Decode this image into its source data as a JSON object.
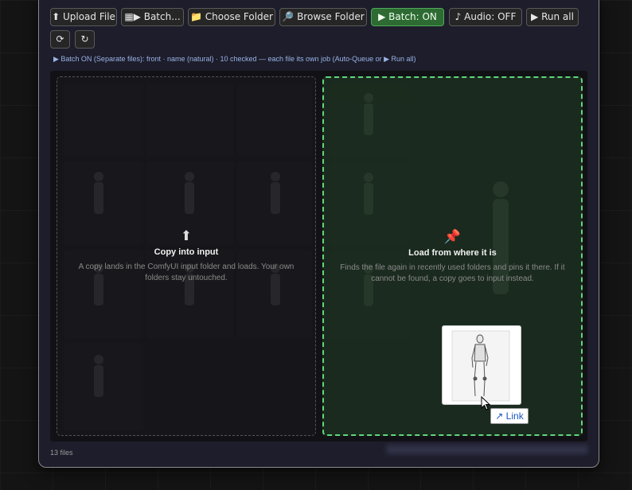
{
  "toolbar": {
    "upload_label": "⬆ Upload File",
    "batch_label": "▦▶ Batch...",
    "choose_folder_label": "📁 Choose Folder",
    "browse_folder_label": "🔎 Browse Folder",
    "batch_on_label": "▶ Batch: ON",
    "audio_label": "♪ Audio: OFF",
    "run_all_label": "▶ Run all",
    "refresh_glyph": "⟳",
    "reload_glyph": "↻"
  },
  "status_line": "▶ Batch ON (Separate files): front · name (natural) · 10 checked — each file its own job (Auto-Queue or ▶ Run all)",
  "drop_zones": {
    "left": {
      "icon": "⬆",
      "title": "Copy into input",
      "description": "A copy lands in the ComfyUI input folder and loads. Your own folders stay untouched."
    },
    "right": {
      "icon": "📌",
      "title": "Load from where it is",
      "description": "Finds the file again in recently used folders and pins it there. If it cannot be found, a copy goes to input instead."
    }
  },
  "drag": {
    "link_label": "↗ Link",
    "preview_icon": "figure-thumbnail"
  },
  "footer": {
    "file_count": "13 files"
  },
  "colors": {
    "accent_green": "#5fd87a",
    "batch_button": "#2e6b33",
    "status_text": "#9ab4e6",
    "panel_bg": "#1d1d2b"
  }
}
